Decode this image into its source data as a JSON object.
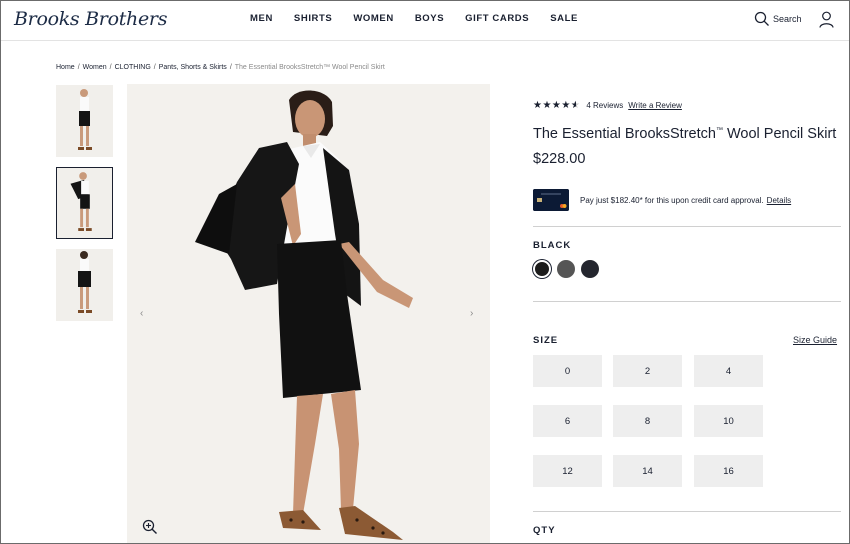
{
  "header": {
    "logo": "Brooks Brothers",
    "nav": [
      "MEN",
      "SHIRTS",
      "WOMEN",
      "BOYS",
      "GIFT CARDS",
      "SALE"
    ],
    "search_label": "Search",
    "icons": [
      "search-icon",
      "user-icon"
    ]
  },
  "breadcrumb": {
    "items": [
      "Home",
      "Women",
      "CLOTHING",
      "Pants, Shorts & Skirts"
    ],
    "current": "The Essential BrooksStretch™ Wool Pencil Skirt"
  },
  "gallery": {
    "thumbnail_count": 3,
    "selected_thumbnail": 2,
    "icons": [
      "chevron-left-icon",
      "chevron-right-icon",
      "zoom-icon"
    ]
  },
  "product": {
    "rating": 4.5,
    "reviews": "4 Reviews",
    "write_review": "Write a Review",
    "title": "The Essential BrooksStretch",
    "title_mark": "™",
    "title_rest": " Wool Pencil Skirt",
    "price": "$228.00",
    "promo_text": "Pay just $182.40* for this upon credit card approval.",
    "promo_link": "Details",
    "color_label": "BLACK",
    "swatches": [
      "#1c1c1c",
      "#555555",
      "#24262e"
    ],
    "size_label": "SIZE",
    "size_guide": "Size Guide",
    "sizes": [
      "0",
      "2",
      "4",
      "6",
      "8",
      "10",
      "12",
      "14",
      "16"
    ],
    "qty_label": "QTY"
  },
  "colors": {
    "text": "#1a2030",
    "brand_navy": "#1c2b45",
    "size_bg": "#eeeeee"
  }
}
